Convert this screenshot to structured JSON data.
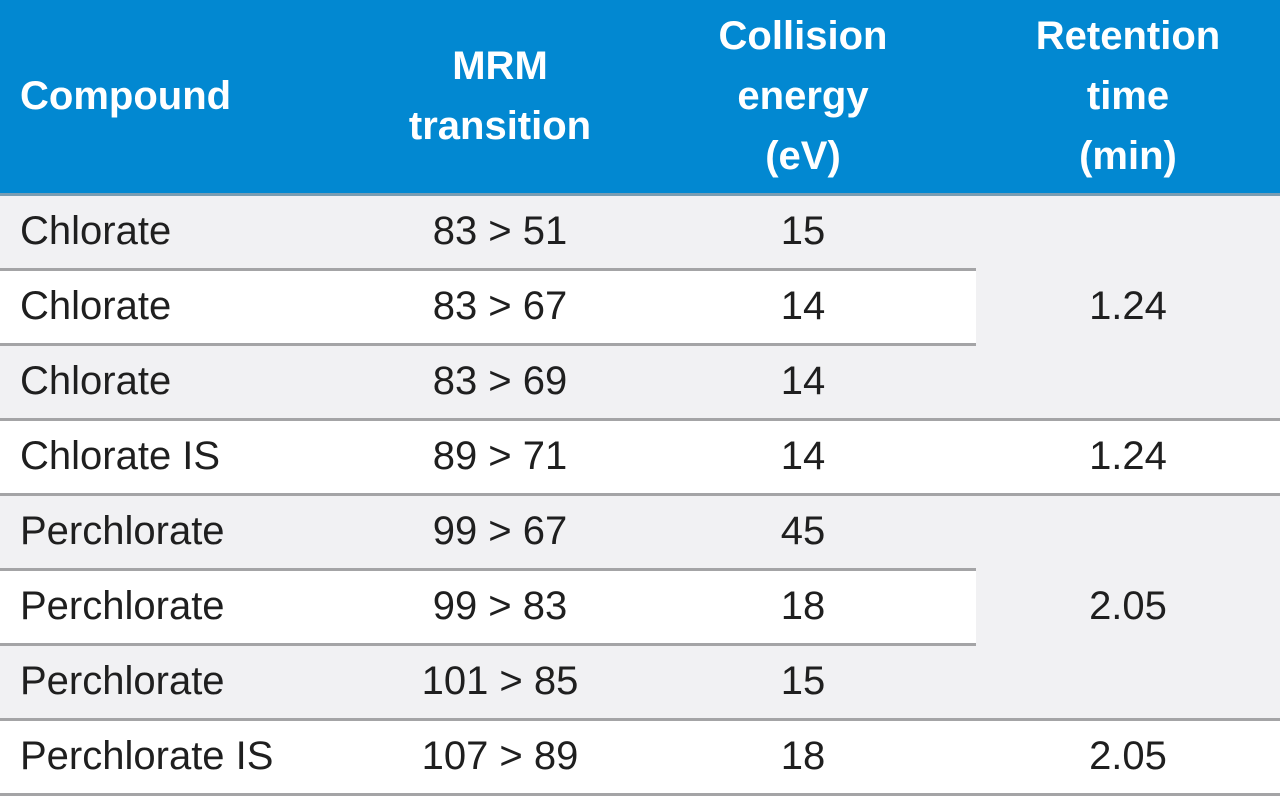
{
  "table": {
    "headers": {
      "compound": "Compound",
      "mrm_line1": "MRM",
      "mrm_line2": "transition",
      "ce_line1": "Collision",
      "ce_line2": "energy",
      "ce_line3": "(eV)",
      "rt_line1": "Retention",
      "rt_line2": "time",
      "rt_line3": "(min)"
    },
    "rows": [
      {
        "compound": "Chlorate",
        "transition": "83 > 51",
        "collision_energy": "15"
      },
      {
        "compound": "Chlorate",
        "transition": "83 > 67",
        "collision_energy": "14"
      },
      {
        "compound": "Chlorate",
        "transition": "83 > 69",
        "collision_energy": "14"
      },
      {
        "compound": "Chlorate IS",
        "transition": "89 > 71",
        "collision_energy": "14"
      },
      {
        "compound": "Perchlorate",
        "transition": "99 > 67",
        "collision_energy": "45"
      },
      {
        "compound": "Perchlorate",
        "transition": "99 > 83",
        "collision_energy": "18"
      },
      {
        "compound": "Perchlorate",
        "transition": "101 > 85",
        "collision_energy": "15"
      },
      {
        "compound": "Perchlorate IS",
        "transition": "107 > 89",
        "collision_energy": "18"
      }
    ],
    "retention_groups": [
      {
        "value": "1.24",
        "row_span": 3
      },
      {
        "value": "1.24",
        "row_span": 1
      },
      {
        "value": "2.05",
        "row_span": 3
      },
      {
        "value": "2.05",
        "row_span": 1
      }
    ]
  },
  "colors": {
    "header_bg": "#0288d1",
    "header_text": "#ffffff",
    "row_shade": "#f1f1f3",
    "row_plain": "#ffffff",
    "border": "#a4a4a6"
  }
}
